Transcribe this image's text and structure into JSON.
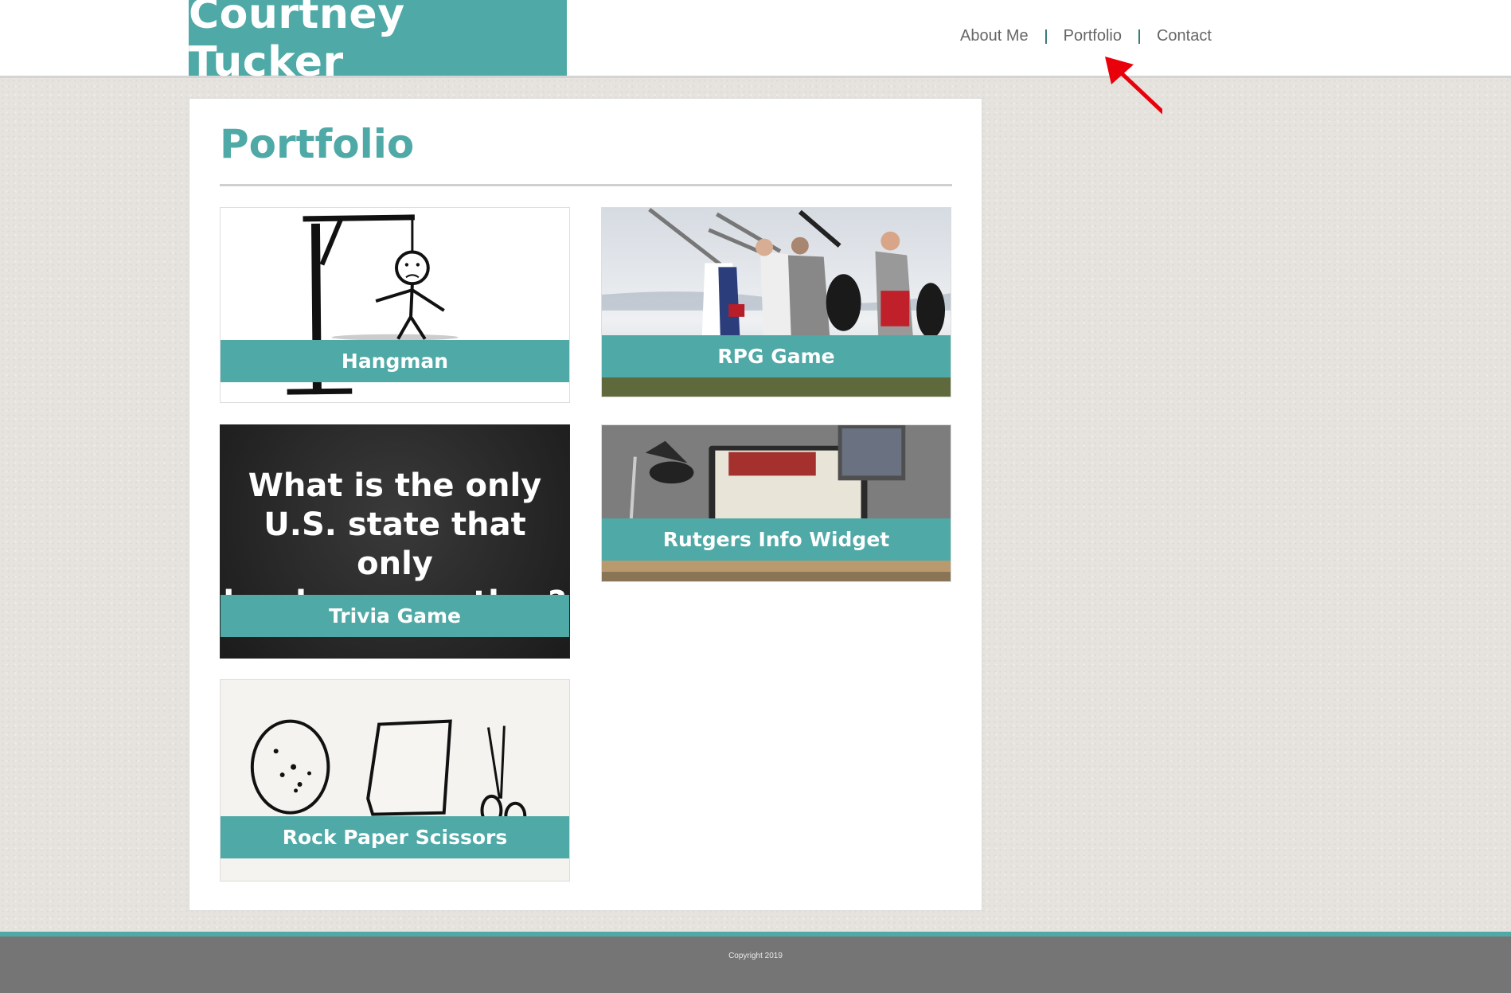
{
  "header": {
    "brand": "Courtney Tucker"
  },
  "nav": {
    "items": [
      "About Me",
      "Portfolio",
      "Contact"
    ]
  },
  "main": {
    "title": "Portfolio",
    "projects": [
      {
        "label": "Hangman",
        "icon": "hangman-image"
      },
      {
        "label": "RPG Game",
        "icon": "knights-photo"
      },
      {
        "label": "Trivia Game",
        "icon": "chalkboard-image",
        "chalkboard_text": [
          "What is the only",
          "U.S. state that only",
          "borders one other?"
        ]
      },
      {
        "label": "Rutgers Info Widget",
        "icon": "desk-monitor-photo"
      },
      {
        "label": "Rock Paper Scissors",
        "icon": "rock-paper-scissors-image"
      }
    ]
  },
  "footer": {
    "copyright": "Copyright 2019"
  },
  "colors": {
    "accent": "#4fa9a6",
    "footer": "#757575",
    "annotation_arrow": "#e8000b"
  }
}
